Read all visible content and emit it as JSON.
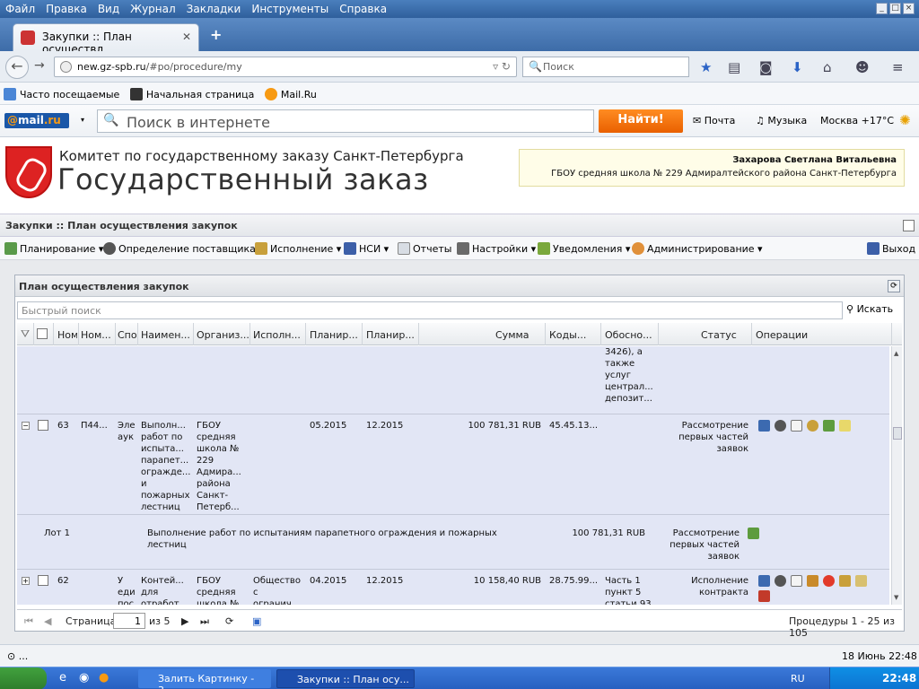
{
  "browser": {
    "menu": [
      "Файл",
      "Правка",
      "Вид",
      "Журнал",
      "Закладки",
      "Инструменты",
      "Справка"
    ],
    "tab_title": "Закупки :: План осуществл...",
    "url_host": "new.gz-spb.ru",
    "url_path": "/#po/procedure/my",
    "search_placeholder": "Поиск",
    "bookmarks": [
      "Часто посещаемые",
      "Начальная страница",
      "Mail.Ru"
    ]
  },
  "mailru": {
    "logo_at": "@",
    "logo_mail": "mail",
    "logo_ru": ".ru",
    "search_placeholder": "Поиск в интернете",
    "find_label": "Найти!",
    "mail_label": "Почта",
    "music_label": "Музыка",
    "weather": "Москва +17°C"
  },
  "site": {
    "org_title": "Комитет по государственному заказу Санкт-Петербурга",
    "big_title": "Государственный заказ",
    "user_name": "Захарова Светлана Витальевна",
    "user_org": "ГБОУ средняя школа № 229 Адмиралтейского района Санкт-Петербурга",
    "breadcrumb": "Закупки :: План осуществления закупок"
  },
  "toolbar": {
    "planning": "Планирование ▾",
    "supplier": "Определение поставщика ▾",
    "execution": "Исполнение ▾",
    "nsi": "НСИ ▾",
    "reports": "Отчеты",
    "settings": "Настройки ▾",
    "notifications": "Уведомления ▾",
    "admin": "Администрирование ▾",
    "exit": "Выход"
  },
  "panel": {
    "title": "План осуществления закупок",
    "quick_search_placeholder": "Быстрый поиск",
    "search_button": "Искать",
    "columns": [
      "Ном",
      "Ном...",
      "Спо",
      "Наимен...",
      "Организ...",
      "Исполн...",
      "Планир...",
      "Планир...",
      "Сумма",
      "Коды...",
      "Обосно...",
      "Статус",
      "Операции"
    ]
  },
  "rows": {
    "partial_basis": "3426), а\nтакже\nуслуг\nцентрал...\nдепозит...",
    "r63": {
      "num": "63",
      "num2": "П44...",
      "method": "Эле\nаук",
      "name": "Выполн...\nработ по\nиспыта...\nпарапет...\nогражде...\nи\nпожарных\nлестниц",
      "org": "ГБОУ\nсредняя\nшкола №\n229\nАдмира...\nрайона\nСанкт-\nПетерб...",
      "plan_start": "05.2015",
      "plan_end": "12.2015",
      "sum": "100 781,31 RUB",
      "codes": "45.45.13...",
      "status": "Рассмотрение\nпервых частей\nзаявок"
    },
    "lot": {
      "label": "Лот 1",
      "name": "Выполнение работ по испытаниям парапетного ограждения и пожарных\nлестниц",
      "sum": "100 781,31 RUB",
      "status": "Рассмотрение\nпервых частей\nзаявок"
    },
    "r62": {
      "num": "62",
      "method": "У\nеди\nпос",
      "name": "Контей...\nдля\nотработ...",
      "org": "ГБОУ\nсредняя\nшкола №",
      "executor": "Общество\nс\nогранич...",
      "plan_start": "04.2015",
      "plan_end": "12.2015",
      "sum": "10 158,40 RUB",
      "codes": "28.75.99...",
      "basis": "Часть 1\nпункт 5\nстатьи 93",
      "status": "Исполнение\nконтракта"
    }
  },
  "pager": {
    "page_label": "Страница",
    "page_value": "1",
    "of_label": "из 5",
    "summary": "Процедуры 1 - 25 из 105"
  },
  "status": {
    "left": "...",
    "right": "18 Июнь 22:48"
  },
  "taskbar": {
    "task1": "Залить Картинку - 3...",
    "task2": "Закупки :: План осу...",
    "lang": "RU",
    "clock": "22:48"
  }
}
